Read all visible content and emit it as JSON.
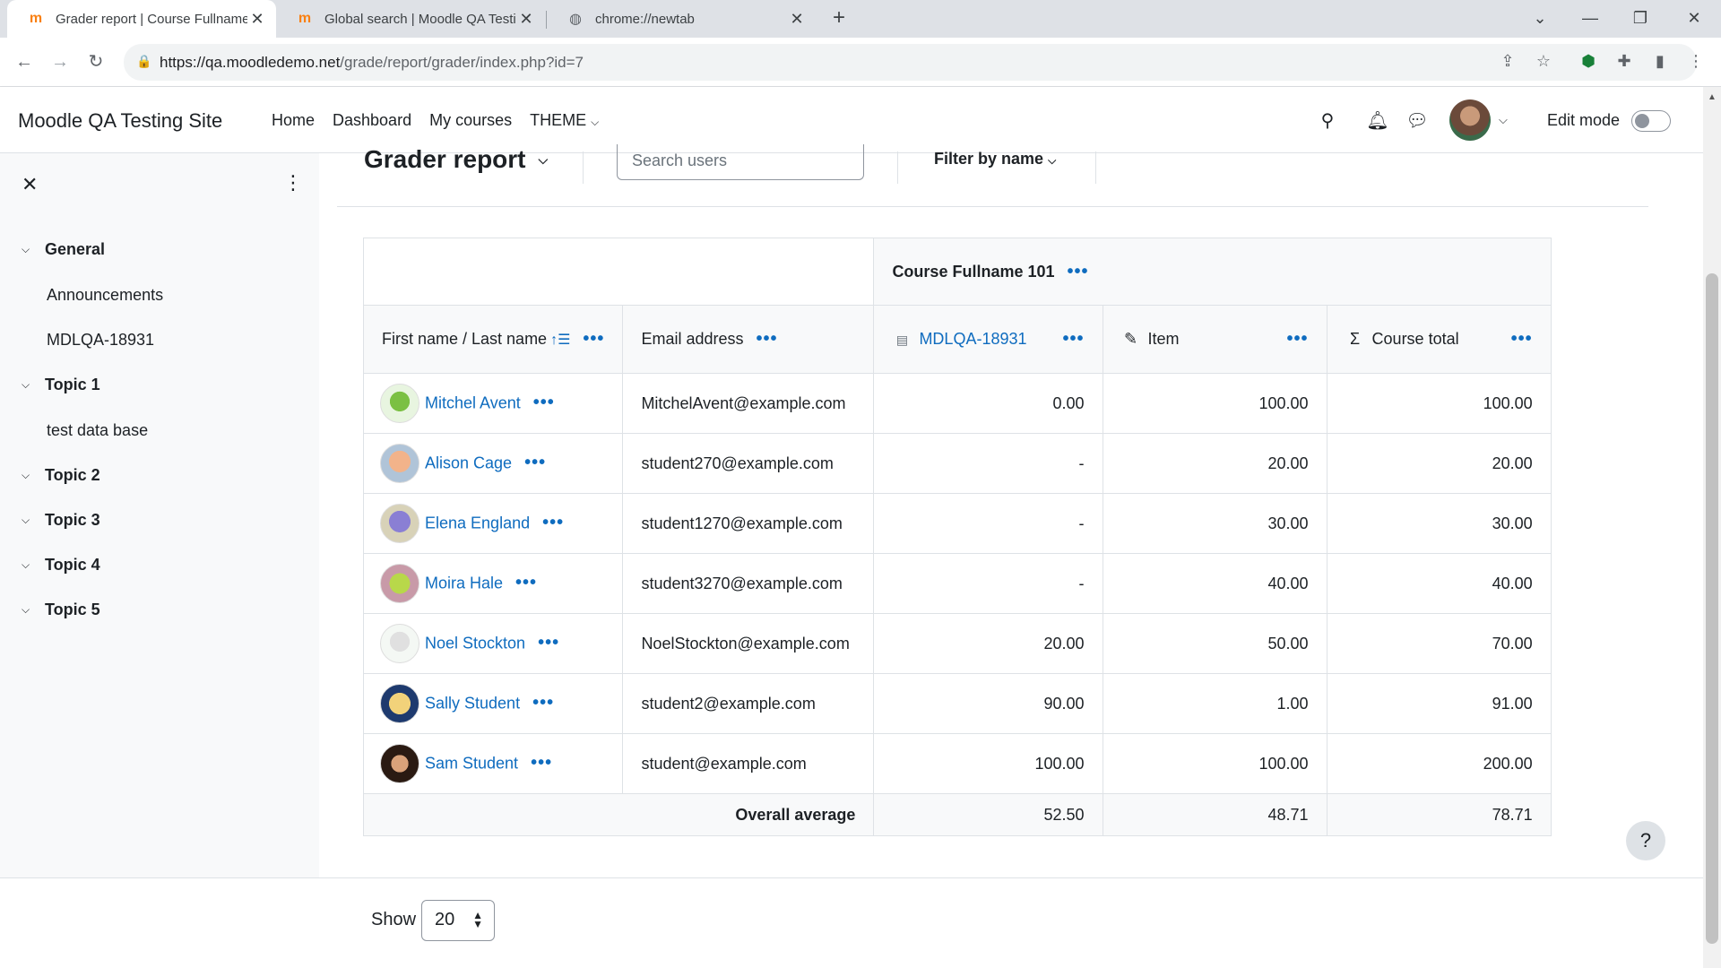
{
  "browser": {
    "tabs": [
      {
        "title": "Grader report | Course Fullname",
        "icon": "moodle-icon"
      },
      {
        "title": "Global search | Moodle QA Testin",
        "icon": "moodle-icon"
      },
      {
        "title": "chrome://newtab",
        "icon": "globe-icon"
      }
    ],
    "url_host": "https://qa.moodledemo.net",
    "url_path": "/grade/report/grader/index.php?id=7"
  },
  "site": {
    "name": "Moodle QA Testing Site",
    "nav": [
      "Home",
      "Dashboard",
      "My courses",
      "THEME"
    ],
    "edit_mode_label": "Edit mode"
  },
  "course_index": {
    "sections": [
      {
        "title": "General",
        "items": [
          "Announcements",
          "MDLQA-18931"
        ]
      },
      {
        "title": "Topic 1",
        "items": [
          "test data base"
        ]
      },
      {
        "title": "Topic 2",
        "items": []
      },
      {
        "title": "Topic 3",
        "items": []
      },
      {
        "title": "Topic 4",
        "items": []
      },
      {
        "title": "Topic 5",
        "items": []
      }
    ]
  },
  "report": {
    "heading": "Grader report",
    "search_placeholder": "Search users",
    "filter_label": "Filter by name",
    "category": "Course Fullname 101",
    "columns": {
      "name": "First name / Last name",
      "email": "Email address",
      "item1": "MDLQA-18931",
      "item2": "Item",
      "total": "Course total"
    },
    "rows": [
      {
        "name": "Mitchel Avent",
        "email": "MitchelAvent@example.com",
        "g1": "0.00",
        "g2": "100.00",
        "total": "100.00"
      },
      {
        "name": "Alison Cage",
        "email": "student270@example.com",
        "g1": "-",
        "g2": "20.00",
        "total": "20.00"
      },
      {
        "name": "Elena England",
        "email": "student1270@example.com",
        "g1": "-",
        "g2": "30.00",
        "total": "30.00"
      },
      {
        "name": "Moira Hale",
        "email": "student3270@example.com",
        "g1": "-",
        "g2": "40.00",
        "total": "40.00"
      },
      {
        "name": "Noel Stockton",
        "email": "NoelStockton@example.com",
        "g1": "20.00",
        "g2": "50.00",
        "total": "70.00"
      },
      {
        "name": "Sally Student",
        "email": "student2@example.com",
        "g1": "90.00",
        "g2": "1.00",
        "total": "91.00"
      },
      {
        "name": "Sam Student",
        "email": "student@example.com",
        "g1": "100.00",
        "g2": "100.00",
        "total": "200.00"
      }
    ],
    "average": {
      "label": "Overall average",
      "g1": "52.50",
      "g2": "48.71",
      "total": "78.71"
    }
  },
  "pagination": {
    "show_label": "Show",
    "per_page": "20"
  },
  "help_label": "?",
  "colors": {
    "link": "#0f6cbf",
    "drawer_bg": "#f8f9fa"
  }
}
